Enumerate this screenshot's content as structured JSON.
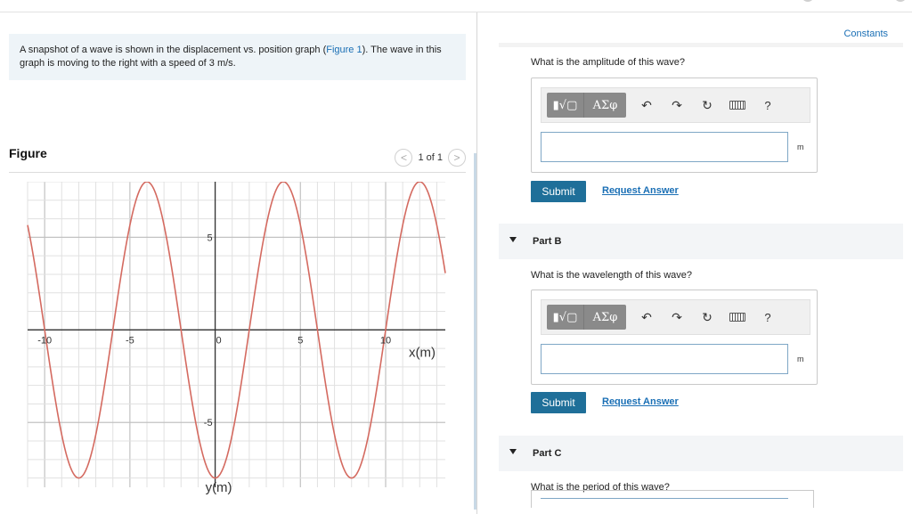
{
  "problem": {
    "text_before": "A snapshot of a wave is shown in the displacement vs. position graph (",
    "figure_link": "Figure 1",
    "text_after": ").  The wave in this graph is moving to the right with a speed of 3 m/s."
  },
  "figure": {
    "title": "Figure",
    "pager_text": "1 of 1",
    "prev_icon": "<",
    "next_icon": ">"
  },
  "chart_data": {
    "type": "line",
    "xlabel": "x(m)",
    "ylabel": "y(m)",
    "xlim": [
      -11,
      13.5
    ],
    "ylim": [
      -8.5,
      8
    ],
    "x_ticks": [
      -10,
      -5,
      0,
      5,
      10
    ],
    "y_ticks": [
      5,
      -5
    ],
    "grid": true,
    "series": [
      {
        "function": "y = 8 cos(2*pi*(x - 4)/8)",
        "amplitude": 8,
        "wavelength": 8,
        "crest_x": [
          -4,
          4,
          12
        ],
        "trough_x": [
          -8,
          0,
          8
        ],
        "color": "#d46a60"
      }
    ]
  },
  "right": {
    "constants_label": "Constants",
    "partA": {
      "question": "What is the amplitude of this wave?",
      "unit": "m",
      "submit": "Submit",
      "request": "Request Answer"
    },
    "partB": {
      "label": "Part B",
      "question": "What is the wavelength of this wave?",
      "unit": "m",
      "submit": "Submit",
      "request": "Request Answer"
    },
    "partC": {
      "label": "Part C",
      "question": "What is the period of this wave?"
    },
    "toolbar": {
      "templates_label": "▮√▢",
      "greek_label": "ΑΣφ",
      "undo_icon": "↶",
      "redo_icon": "↷",
      "reset_icon": "↻",
      "help_label": "?"
    }
  }
}
